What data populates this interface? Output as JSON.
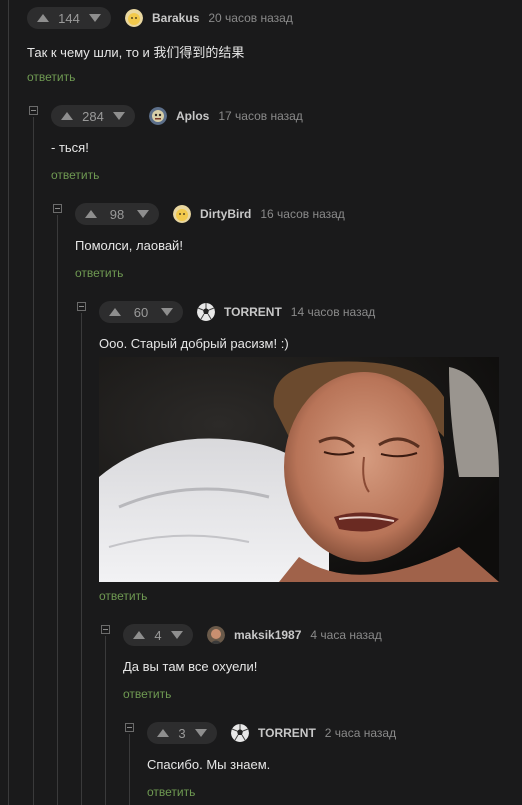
{
  "colors": {
    "background": "#1a1a1b",
    "rating_bg": "#2d2d2e",
    "reply_link": "#6f9a52",
    "username": "#c8c8c8",
    "text": "#e6e6e6"
  },
  "comments": [
    {
      "score": "144",
      "username": "Barakus",
      "time": "20 часов назад",
      "avatar": "yellow-face-avatar",
      "text": "Так к чему шли, то и 我们得到的结果",
      "reply": "ответить"
    },
    {
      "score": "284",
      "username": "Aplos",
      "time": "17 часов назад",
      "avatar": "cartoon-avatar",
      "text": "- ться!",
      "reply": "ответить"
    },
    {
      "score": "98",
      "username": "DirtyBird",
      "time": "16 часов назад",
      "avatar": "yellow-face-avatar",
      "text": "Помолси, лаовай!",
      "reply": "ответить"
    },
    {
      "score": "60",
      "username": "TORRENT",
      "time": "14 часов назад",
      "avatar": "soccer-ball-avatar",
      "text": "Ооо. Старый добрый расизм! :)",
      "image": "crying-man-on-pillow-photo",
      "reply": "ответить"
    },
    {
      "score": "4",
      "username": "maksik1987",
      "time": "4 часа назад",
      "avatar": "photo-avatar",
      "text": "Да вы там все охуели!",
      "reply": "ответить"
    },
    {
      "score": "3",
      "username": "TORRENT",
      "time": "2 часа назад",
      "avatar": "soccer-ball-avatar",
      "text": "Спасибо. Мы знаем.",
      "reply": "ответить"
    }
  ]
}
